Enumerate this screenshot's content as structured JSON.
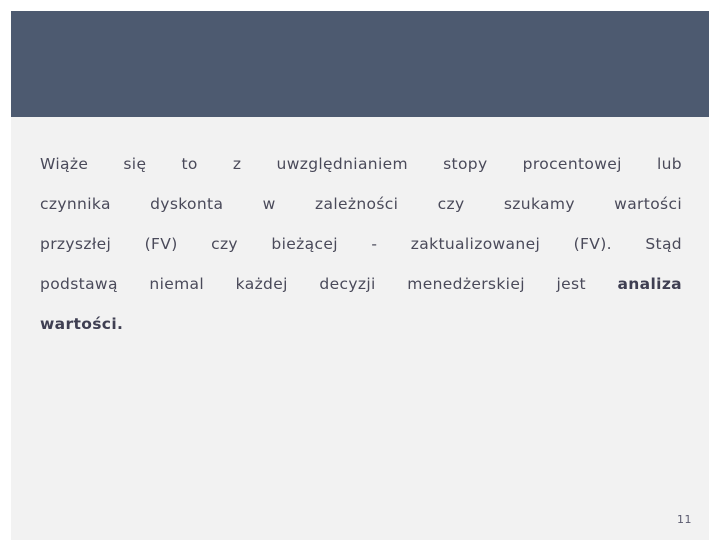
{
  "slide": {
    "header": {
      "title": "",
      "band_color": "#4d5a70"
    },
    "background_color": "#f2f2f2",
    "text_color": "#4a4a5a",
    "body": {
      "lines": [
        {
          "id": "line-1",
          "segments": [
            {
              "text": "Wiąże się to z uwzględnianiem stopy procentowej lub",
              "bold": false
            }
          ]
        },
        {
          "id": "line-2",
          "segments": [
            {
              "text": "czynnika dyskonta w zależności czy szukamy wartości",
              "bold": false
            }
          ]
        },
        {
          "id": "line-3",
          "segments": [
            {
              "text": "przyszłej (FV) czy bieżącej - zaktualizowanej (FV). Stąd",
              "bold": false
            }
          ]
        },
        {
          "id": "line-4",
          "segments": [
            {
              "text": "podstawą niemal każdej decyzji menedżerskiej jest ",
              "bold": false
            },
            {
              "text": "analiza",
              "bold": true
            }
          ]
        },
        {
          "id": "line-5",
          "segments": [
            {
              "text": "wartości.",
              "bold": true
            }
          ]
        }
      ],
      "plain_text": "Wiąże się to z uwzględnianiem stopy procentowej lub czynnika dyskonta w zależności czy szukamy wartości przyszłej (FV) czy bieżącej - zaktualizowanej (FV). Stąd podstawą niemal każdej decyzji menedżerskiej jest analiza wartości."
    },
    "footer": {
      "page_number": "11"
    }
  }
}
